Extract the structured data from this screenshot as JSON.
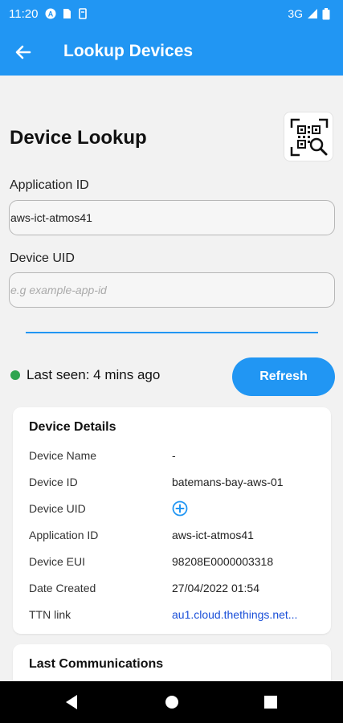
{
  "status_bar": {
    "time": "11:20",
    "network": "3G",
    "icons_left": [
      "at-sign-icon",
      "sim-card-icon",
      "storage-icon"
    ],
    "icons_right": [
      "signal-icon",
      "battery-icon"
    ]
  },
  "app_bar": {
    "title": "Lookup Devices",
    "back_icon": "arrow-left-icon"
  },
  "page": {
    "heading": "Device Lookup",
    "qr_icon": "qr-scan-icon"
  },
  "form": {
    "application_id_label": "Application ID",
    "application_id_value": "aws-ict-atmos41",
    "device_uid_label": "Device UID",
    "device_uid_value": "",
    "device_uid_placeholder": "e.g example-app-id"
  },
  "status": {
    "last_seen": "Last seen: 4 mins ago",
    "dot_color": "#2ea44f",
    "refresh_label": "Refresh"
  },
  "device_details": {
    "title": "Device Details",
    "rows": [
      {
        "key": "Device Name",
        "value": "-"
      },
      {
        "key": "Device ID",
        "value": "batemans-bay-aws-01"
      },
      {
        "key": "Device UID",
        "value": "",
        "icon": "add-circle-icon"
      },
      {
        "key": "Application ID",
        "value": "aws-ict-atmos41"
      },
      {
        "key": "Device EUI",
        "value": "98208E0000003318"
      },
      {
        "key": "Date Created",
        "value": "27/04/2022 01:54"
      },
      {
        "key": "TTN link",
        "value": "au1.cloud.thethings.net..."
      }
    ]
  },
  "last_communications": {
    "title": "Last Communications"
  },
  "colors": {
    "accent": "#2196f3",
    "link": "#1a4fd8"
  }
}
